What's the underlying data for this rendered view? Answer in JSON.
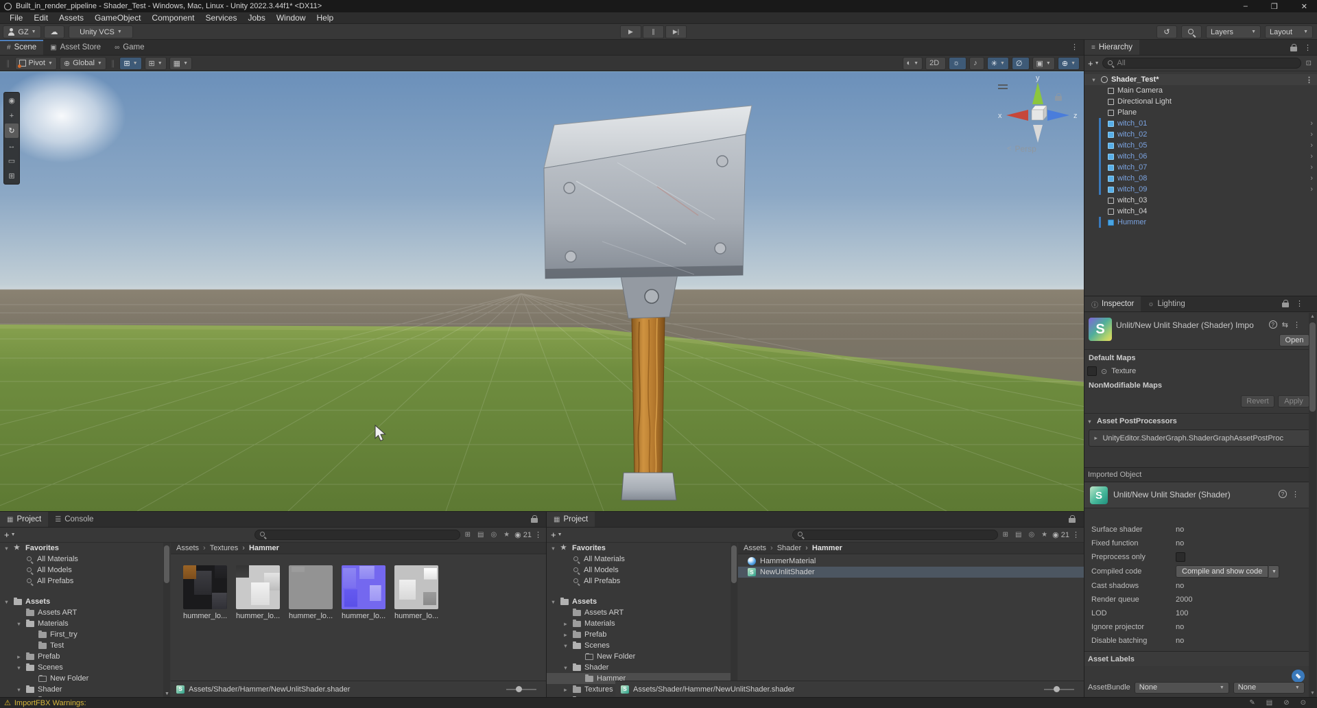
{
  "titlebar": {
    "title": "Built_in_render_pipeline - Shader_Test - Windows, Mac, Linux - Unity 2022.3.44f1* <DX11>",
    "window_controls": [
      {
        "name": "minimize",
        "glyph": "–"
      },
      {
        "name": "maximize",
        "glyph": "❒"
      },
      {
        "name": "close",
        "glyph": "✕"
      }
    ]
  },
  "menubar": {
    "items": [
      {
        "label": "File"
      },
      {
        "label": "Edit"
      },
      {
        "label": "Assets"
      },
      {
        "label": "GameObject"
      },
      {
        "label": "Component"
      },
      {
        "label": "Services"
      },
      {
        "label": "Jobs"
      },
      {
        "label": "Window"
      },
      {
        "label": "Help"
      }
    ]
  },
  "toolbar": {
    "account_label": "GZ",
    "vcs_label": "Unity VCS",
    "layers_label": "Layers",
    "layout_label": "Layout",
    "play_controls": [
      {
        "name": "play-icon",
        "glyph": "▶"
      },
      {
        "name": "pause-icon",
        "glyph": "∥"
      },
      {
        "name": "step-icon",
        "glyph": "▶|"
      }
    ]
  },
  "scene": {
    "tabs": [
      {
        "label": "Scene",
        "glyph": "#",
        "cls": "active focused"
      },
      {
        "label": "Asset Store",
        "glyph": "▣",
        "cls": ""
      },
      {
        "label": "Game",
        "glyph": "∞",
        "cls": ""
      }
    ],
    "pivot_label": "Pivot",
    "global_label": "Global",
    "snap_buttons": [
      {
        "name": "grid-visibility-button",
        "glyph": "⊞",
        "cls": "blue"
      },
      {
        "name": "grid-snap-button",
        "glyph": "⊞",
        "cls": ""
      },
      {
        "name": "snap-increment-button",
        "glyph": "▦",
        "cls": ""
      }
    ],
    "view_buttons": [
      {
        "name": "shading-mode-button",
        "glyph": "◐",
        "cls": "",
        "caret": "▼"
      },
      {
        "name": "2d-toggle-button",
        "glyph": "2D",
        "cls": "",
        "caret": ""
      },
      {
        "name": "lighting-toggle-button",
        "glyph": "☼",
        "cls": "blue",
        "caret": ""
      },
      {
        "name": "audio-toggle-button",
        "glyph": "♪",
        "cls": "",
        "caret": ""
      },
      {
        "name": "effects-toggle-button",
        "glyph": "✳",
        "cls": "blue",
        "caret": "▼"
      },
      {
        "name": "visibility-toggle-button",
        "glyph": "∅",
        "cls": "blue",
        "caret": ""
      },
      {
        "name": "camera-settings-button",
        "glyph": "▣",
        "cls": "",
        "caret": "▼"
      },
      {
        "name": "gizmos-button",
        "glyph": "⊕",
        "cls": "blue",
        "caret": "▼"
      }
    ],
    "tools": [
      {
        "name": "view-tool",
        "glyph": "◉",
        "cls": ""
      },
      {
        "name": "move-tool",
        "glyph": "+",
        "cls": ""
      },
      {
        "name": "rotate-tool",
        "glyph": "↻",
        "cls": "active"
      },
      {
        "name": "scale-tool",
        "glyph": "↔",
        "cls": ""
      },
      {
        "name": "rect-tool",
        "glyph": "▭",
        "cls": ""
      },
      {
        "name": "transform-tool",
        "glyph": "⊞",
        "cls": ""
      }
    ],
    "gizmo": {
      "x": "x",
      "y": "y",
      "z": "z",
      "persp": "Persp"
    }
  },
  "hierarchy": {
    "title": "Hierarchy",
    "search_placeholder": "All",
    "scene_name": "Shader_Test*",
    "items": [
      {
        "label": "Main Camera",
        "icon": "icon-cube",
        "cls": ""
      },
      {
        "label": "Directional Light",
        "icon": "icon-cube",
        "cls": ""
      },
      {
        "label": "Plane",
        "icon": "icon-cube",
        "cls": ""
      },
      {
        "label": "witch_01",
        "icon": "icon-prefab",
        "cls": "blue bar arrow"
      },
      {
        "label": "witch_02",
        "icon": "icon-prefab",
        "cls": "blue bar arrow"
      },
      {
        "label": "witch_05",
        "icon": "icon-prefab",
        "cls": "blue bar arrow"
      },
      {
        "label": "witch_06",
        "icon": "icon-prefab",
        "cls": "blue bar arrow"
      },
      {
        "label": "witch_07",
        "icon": "icon-prefab",
        "cls": "blue bar arrow"
      },
      {
        "label": "witch_08",
        "icon": "icon-prefab",
        "cls": "blue bar arrow"
      },
      {
        "label": "witch_09",
        "icon": "icon-prefab",
        "cls": "blue bar arrow"
      },
      {
        "label": "witch_03",
        "icon": "icon-cube",
        "cls": ""
      },
      {
        "label": "witch_04",
        "icon": "icon-cube",
        "cls": ""
      },
      {
        "label": "Hummer",
        "icon": "icon-model",
        "cls": "blue bar"
      }
    ]
  },
  "inspector": {
    "tabs": [
      {
        "label": "Inspector",
        "glyph": "ⓘ",
        "cls": "active"
      },
      {
        "label": "Lighting",
        "glyph": "☼",
        "cls": ""
      }
    ],
    "importer": {
      "title": "Unlit/New Unlit Shader (Shader) Impo",
      "open_label": "Open",
      "default_maps_label": "Default Maps",
      "texture_label": "Texture",
      "nonmodifiable_label": "NonModifiable Maps",
      "revert_label": "Revert",
      "apply_label": "Apply"
    },
    "postprocessors": {
      "header": "Asset PostProcessors",
      "entry": "UnityEditor.ShaderGraph.ShaderGraphAssetPostProc"
    },
    "imported_object": {
      "header": "Imported Object",
      "title": "Unlit/New Unlit Shader (Shader)"
    },
    "properties": [
      {
        "label": "Surface shader",
        "value": "no",
        "cls": "type-text"
      },
      {
        "label": "Fixed function",
        "value": "no",
        "cls": "type-text"
      },
      {
        "label": "Preprocess only",
        "value": "",
        "cls": "type-checkbox"
      },
      {
        "label": "Compiled code",
        "value": "Compile and show code",
        "cls": "type-button"
      },
      {
        "label": "Cast shadows",
        "value": "no",
        "cls": "type-text"
      },
      {
        "label": "Render queue",
        "value": "2000",
        "cls": "type-text"
      },
      {
        "label": "LOD",
        "value": "100",
        "cls": "type-text"
      },
      {
        "label": "Ignore projector",
        "value": "no",
        "cls": "type-text"
      },
      {
        "label": "Disable batching",
        "value": "no",
        "cls": "type-text"
      }
    ],
    "asset_labels": {
      "header": "Asset Labels",
      "assetbundle_label": "AssetBundle",
      "bundle_value": "None",
      "variant_value": "None"
    }
  },
  "project_left": {
    "tabs": [
      {
        "label": "Project",
        "glyph": "▦",
        "cls": "active"
      },
      {
        "label": "Console",
        "glyph": "☰",
        "cls": ""
      }
    ],
    "hidden_count": "21",
    "tree": [
      {
        "label": "Favorites",
        "icon": "icon-star",
        "cls": "lv0 open bold"
      },
      {
        "label": "All Materials",
        "icon": "icon-search-g",
        "cls": "lv1"
      },
      {
        "label": "All Models",
        "icon": "icon-search-g",
        "cls": "lv1"
      },
      {
        "label": "All Prefabs",
        "icon": "icon-search-g",
        "cls": "lv1"
      },
      {
        "label": "Assets",
        "icon": "icon-folder-open",
        "cls": "lv0 open bold gap"
      },
      {
        "label": "Assets ART",
        "icon": "icon-folder",
        "cls": "lv1"
      },
      {
        "label": "Materials",
        "icon": "icon-folder-open",
        "cls": "lv1 open"
      },
      {
        "label": "First_try",
        "icon": "icon-folder",
        "cls": "lv2"
      },
      {
        "label": "Test",
        "icon": "icon-folder",
        "cls": "lv2"
      },
      {
        "label": "Prefab",
        "icon": "icon-folder",
        "cls": "lv1 closed"
      },
      {
        "label": "Scenes",
        "icon": "icon-folder-open",
        "cls": "lv1 open"
      },
      {
        "label": "New Folder",
        "icon": "icon-folder-empty",
        "cls": "lv2"
      },
      {
        "label": "Shader",
        "icon": "icon-folder-open",
        "cls": "lv1 open"
      },
      {
        "label": "Hammer",
        "icon": "icon-folder",
        "cls": "lv2"
      }
    ],
    "breadcrumb": [
      {
        "label": "Assets",
        "cls": ""
      },
      {
        "label": "Textures",
        "cls": ""
      },
      {
        "label": "Hammer",
        "cls": "current"
      }
    ],
    "thumbnails": [
      {
        "label": "hummer_lo...",
        "cls": "thumb-a"
      },
      {
        "label": "hummer_lo...",
        "cls": "thumb-b"
      },
      {
        "label": "hummer_lo...",
        "cls": "thumb-c"
      },
      {
        "label": "hummer_lo...",
        "cls": "thumb-d"
      },
      {
        "label": "hummer_lo...",
        "cls": "thumb-e"
      }
    ],
    "footer_path": "Assets/Shader/Hammer/NewUnlitShader.shader"
  },
  "project_right": {
    "tabs": [
      {
        "label": "Project",
        "glyph": "▦",
        "cls": "active"
      }
    ],
    "hidden_count": "21",
    "tree": [
      {
        "label": "Favorites",
        "icon": "icon-star",
        "cls": "lv0 open bold"
      },
      {
        "label": "All Materials",
        "icon": "icon-search-g",
        "cls": "lv1"
      },
      {
        "label": "All Models",
        "icon": "icon-search-g",
        "cls": "lv1"
      },
      {
        "label": "All Prefabs",
        "icon": "icon-search-g",
        "cls": "lv1"
      },
      {
        "label": "Assets",
        "icon": "icon-folder-open",
        "cls": "lv0 open bold gap"
      },
      {
        "label": "Assets ART",
        "icon": "icon-folder",
        "cls": "lv1"
      },
      {
        "label": "Materials",
        "icon": "icon-folder",
        "cls": "lv1 closed"
      },
      {
        "label": "Prefab",
        "icon": "icon-folder",
        "cls": "lv1 closed"
      },
      {
        "label": "Scenes",
        "icon": "icon-folder-open",
        "cls": "lv1 open"
      },
      {
        "label": "New Folder",
        "icon": "icon-folder-empty",
        "cls": "lv2"
      },
      {
        "label": "Shader",
        "icon": "icon-folder-open",
        "cls": "lv1 open"
      },
      {
        "label": "Hammer",
        "icon": "icon-folder",
        "cls": "lv2 selected"
      },
      {
        "label": "Textures",
        "icon": "icon-folder",
        "cls": "lv1 closed"
      },
      {
        "label": "ThirdParty",
        "icon": "icon-folder-open",
        "cls": "lv1 open"
      }
    ],
    "breadcrumb": [
      {
        "label": "Assets",
        "cls": ""
      },
      {
        "label": "Shader",
        "cls": ""
      },
      {
        "label": "Hammer",
        "cls": "current"
      }
    ],
    "files": [
      {
        "label": "HammerMaterial",
        "icon": "icon-material",
        "cls": ""
      },
      {
        "label": "NewUnlitShader",
        "icon": "icon-shader",
        "cls": "selected"
      }
    ],
    "footer_path": "Assets/Shader/Hammer/NewUnlitShader.shader"
  },
  "statusbar": {
    "warning": "ImportFBX Warnings:",
    "icons": [
      {
        "name": "debugger-icon",
        "glyph": "✎"
      },
      {
        "name": "collab-layers-icon",
        "glyph": "▤"
      },
      {
        "name": "notifications-muted-icon",
        "glyph": "⊘"
      },
      {
        "name": "status-ok-icon",
        "glyph": "⊙"
      }
    ]
  }
}
